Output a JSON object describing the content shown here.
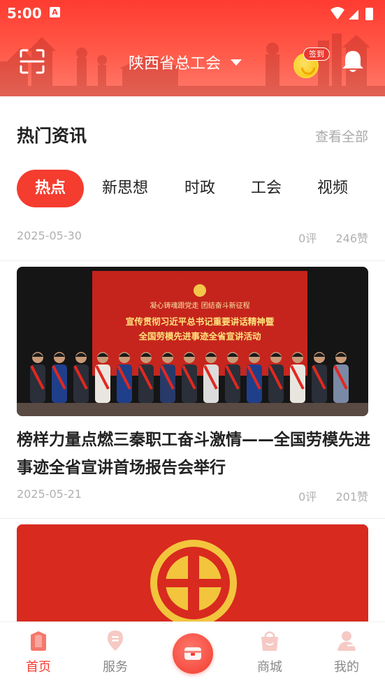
{
  "status_bar": {
    "time": "5:00",
    "app_badge": "A"
  },
  "header": {
    "org_name": "陕西省总工会",
    "sign_in_label": "签到"
  },
  "section": {
    "title": "热门资讯",
    "view_all": "查看全部"
  },
  "tabs": [
    {
      "label": "热点",
      "active": true
    },
    {
      "label": "新思想",
      "active": false
    },
    {
      "label": "时政",
      "active": false
    },
    {
      "label": "工会",
      "active": false
    },
    {
      "label": "视频",
      "active": false
    }
  ],
  "feed": {
    "items": [
      {
        "date": "2025-05-30",
        "comments": "0评",
        "likes": "246赞"
      },
      {
        "title": "榜样力量点燃三秦职工奋斗激情——全国劳模先进事迹全省宣讲首场报告会举行",
        "date": "2025-05-21",
        "comments": "0评",
        "likes": "201赞",
        "image": {
          "banner_line1": "凝心铸魂跟党走 团结奋斗新征程",
          "banner_line2": "宣传贯彻习近平总书记重要讲话精神暨",
          "banner_line3": "全国劳模先进事迹全省宣讲活动"
        }
      },
      {
        "image_type": "trade-union-emblem"
      }
    ]
  },
  "bottom_nav": [
    {
      "label": "首页",
      "icon": "home-icon",
      "active": true
    },
    {
      "label": "服务",
      "icon": "service-icon",
      "active": false
    },
    {
      "label": "",
      "icon": "wallet-icon",
      "active": false
    },
    {
      "label": "商城",
      "icon": "shop-bag-icon",
      "active": false
    },
    {
      "label": "我的",
      "icon": "user-icon",
      "active": false
    }
  ],
  "colors": {
    "accent": "#f43c2f",
    "header_top": "#ff3b30",
    "muted_text": "#b0b0b0"
  }
}
